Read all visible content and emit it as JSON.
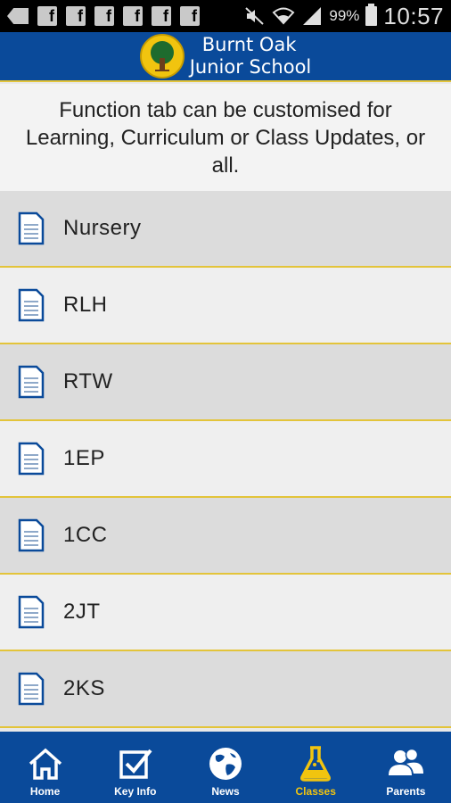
{
  "status_bar": {
    "battery": "99%",
    "time": "10:57",
    "notification_icons": [
      "back-icon",
      "facebook-icon",
      "facebook-icon",
      "facebook-icon",
      "facebook-icon",
      "facebook-icon",
      "facebook-icon"
    ]
  },
  "header": {
    "title_line1": "Burnt Oak",
    "title_line2": "Junior School"
  },
  "intro": {
    "text": "Function tab can be customised for Learning, Curriculum or Class Updates, or all."
  },
  "classes": [
    {
      "label": "Nursery"
    },
    {
      "label": "RLH"
    },
    {
      "label": "RTW"
    },
    {
      "label": "1EP"
    },
    {
      "label": "1CC"
    },
    {
      "label": "2JT"
    },
    {
      "label": "2KS"
    }
  ],
  "nav": {
    "home": "Home",
    "key_info": "Key Info",
    "news": "News",
    "classes": "Classes",
    "parents": "Parents",
    "active": "classes"
  },
  "colors": {
    "brand_blue": "#0a4a9a",
    "accent_yellow": "#f1c40f",
    "divider": "#e3c43a"
  }
}
